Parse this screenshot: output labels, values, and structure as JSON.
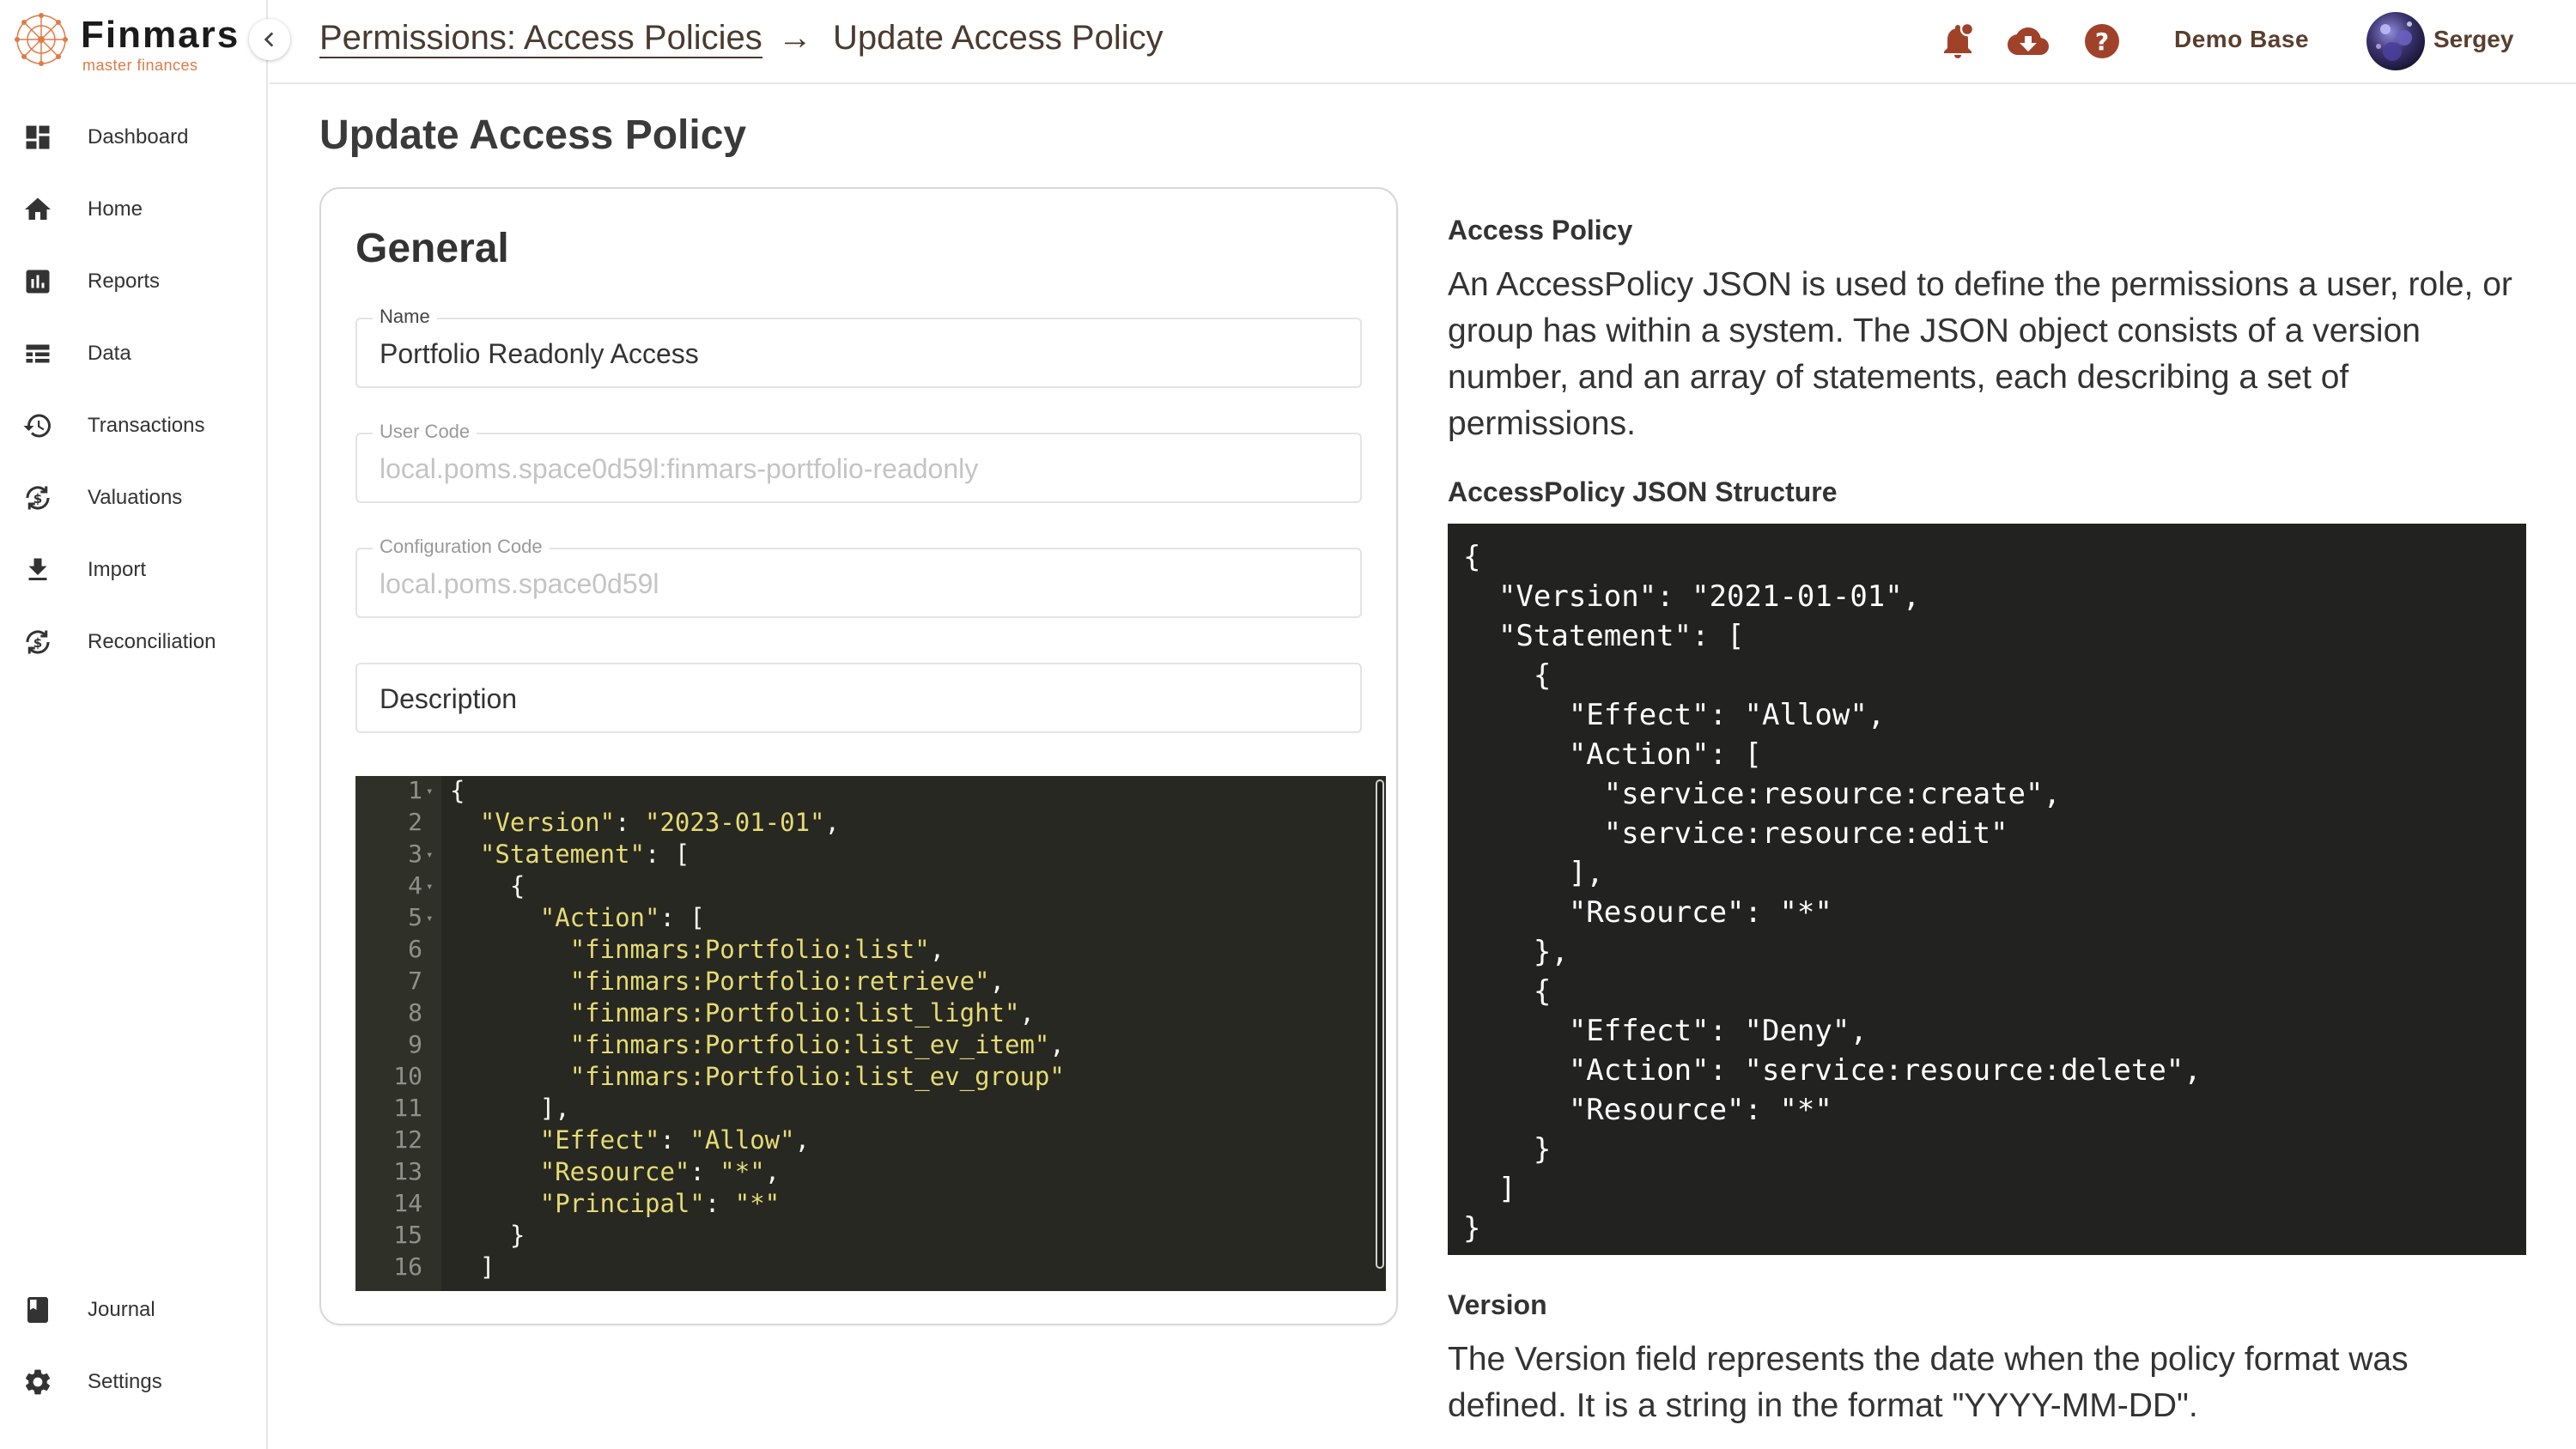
{
  "app": {
    "logo_name": "Finmars",
    "logo_tagline": "master finances"
  },
  "sidebar": {
    "items": [
      {
        "label": "Dashboard",
        "icon": "dashboard-icon"
      },
      {
        "label": "Home",
        "icon": "home-icon"
      },
      {
        "label": "Reports",
        "icon": "reports-icon"
      },
      {
        "label": "Data",
        "icon": "data-icon"
      },
      {
        "label": "Transactions",
        "icon": "history-icon"
      },
      {
        "label": "Valuations",
        "icon": "valuations-icon"
      },
      {
        "label": "Import",
        "icon": "download-icon"
      },
      {
        "label": "Reconciliation",
        "icon": "reconciliation-icon"
      }
    ],
    "bottom_items": [
      {
        "label": "Journal",
        "icon": "book-icon"
      },
      {
        "label": "Settings",
        "icon": "gear-icon"
      }
    ]
  },
  "header": {
    "breadcrumb_link": "Permissions: Access Policies",
    "breadcrumb_separator": "→",
    "breadcrumb_current": "Update Access Policy",
    "workspace": "Demo Base",
    "username": "Sergey"
  },
  "page": {
    "title": "Update Access Policy"
  },
  "form": {
    "section_title": "General",
    "name_label": "Name",
    "name_value": "Portfolio Readonly Access",
    "user_code_label": "User Code",
    "user_code_value": "local.poms.space0d59l:finmars-portfolio-readonly",
    "config_code_label": "Configuration Code",
    "config_code_value": "local.poms.space0d59l",
    "description_placeholder": "Description"
  },
  "editor": {
    "lines": [
      "{",
      "  \"Version\": \"2023-01-01\",",
      "  \"Statement\": [",
      "    {",
      "      \"Action\": [",
      "        \"finmars:Portfolio:list\",",
      "        \"finmars:Portfolio:retrieve\",",
      "        \"finmars:Portfolio:list_light\",",
      "        \"finmars:Portfolio:list_ev_item\",",
      "        \"finmars:Portfolio:list_ev_group\"",
      "      ],",
      "      \"Effect\": \"Allow\",",
      "      \"Resource\": \"*\",",
      "      \"Principal\": \"*\"",
      "    }",
      "  ]"
    ]
  },
  "docs": {
    "heading1": "Access Policy",
    "paragraph1": "An AccessPolicy JSON is used to define the permissions a user, role, or group has within a system. The JSON object consists of a version number, and an array of statements, each describing a set of permissions.",
    "heading2": "AccessPolicy JSON Structure",
    "code": "{\n  \"Version\": \"2021-01-01\",\n  \"Statement\": [\n    {\n      \"Effect\": \"Allow\",\n      \"Action\": [\n        \"service:resource:create\",\n        \"service:resource:edit\"\n      ],\n      \"Resource\": \"*\"\n    },\n    {\n      \"Effect\": \"Deny\",\n      \"Action\": \"service:resource:delete\",\n      \"Resource\": \"*\"\n    }\n  ]\n}",
    "heading3": "Version",
    "paragraph2": "The Version field represents the date when the policy format was defined. It is a string in the format \"YYYY-MM-DD\"."
  },
  "colors": {
    "accent": "#e07a46",
    "header_icon": "#a0422a",
    "editor_bg": "#272822",
    "editor_string": "#e6db74"
  }
}
